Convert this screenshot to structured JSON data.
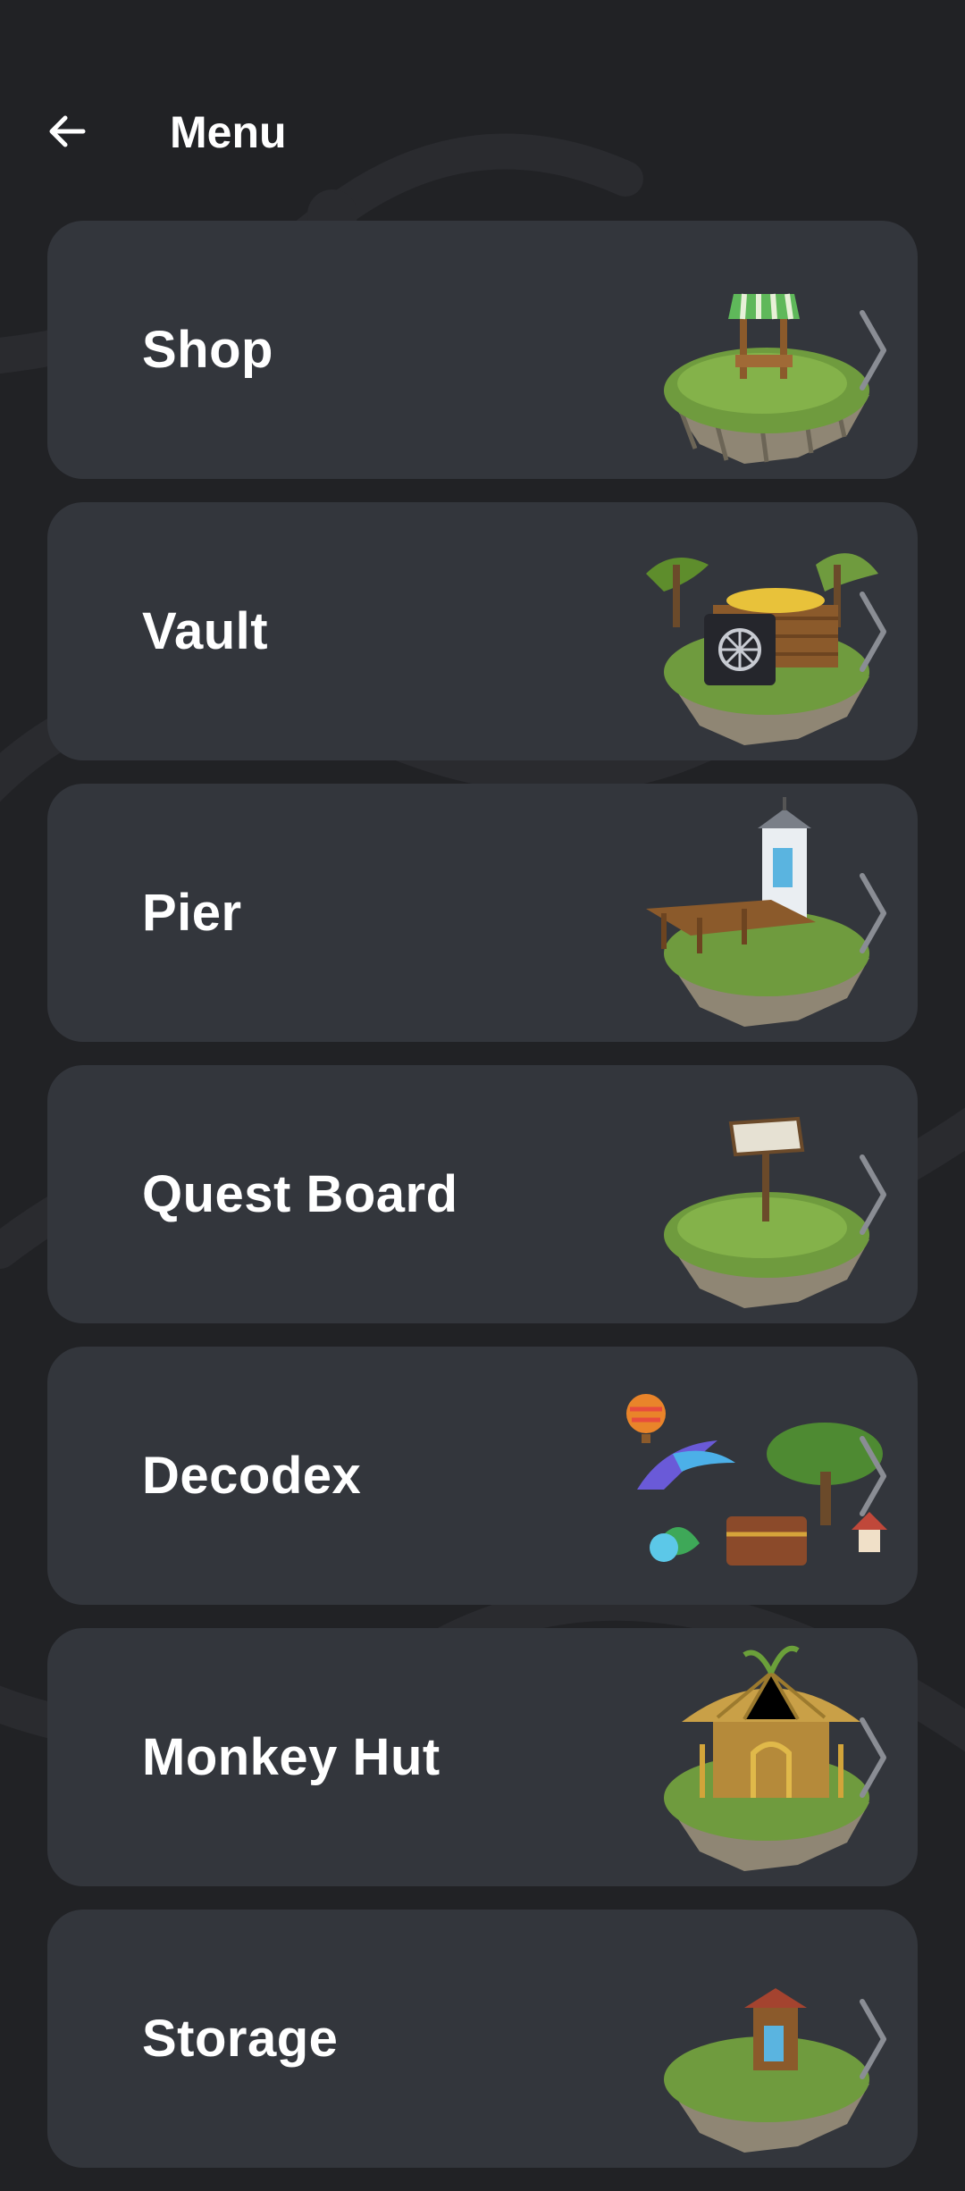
{
  "header": {
    "title": "Menu",
    "back_icon": "arrow-left-icon"
  },
  "menu": {
    "items": [
      {
        "label": "Shop",
        "icon": "shop-island-icon"
      },
      {
        "label": "Vault",
        "icon": "vault-island-icon"
      },
      {
        "label": "Pier",
        "icon": "pier-island-icon"
      },
      {
        "label": "Quest Board",
        "icon": "quest-board-island-icon"
      },
      {
        "label": "Decodex",
        "icon": "decodex-scene-icon"
      },
      {
        "label": "Monkey Hut",
        "icon": "monkey-hut-island-icon"
      },
      {
        "label": "Storage",
        "icon": "storage-island-icon"
      }
    ]
  },
  "colors": {
    "background": "#212225",
    "card": "#33363c",
    "text": "#ffffff",
    "chevron": "#8a8d94"
  }
}
